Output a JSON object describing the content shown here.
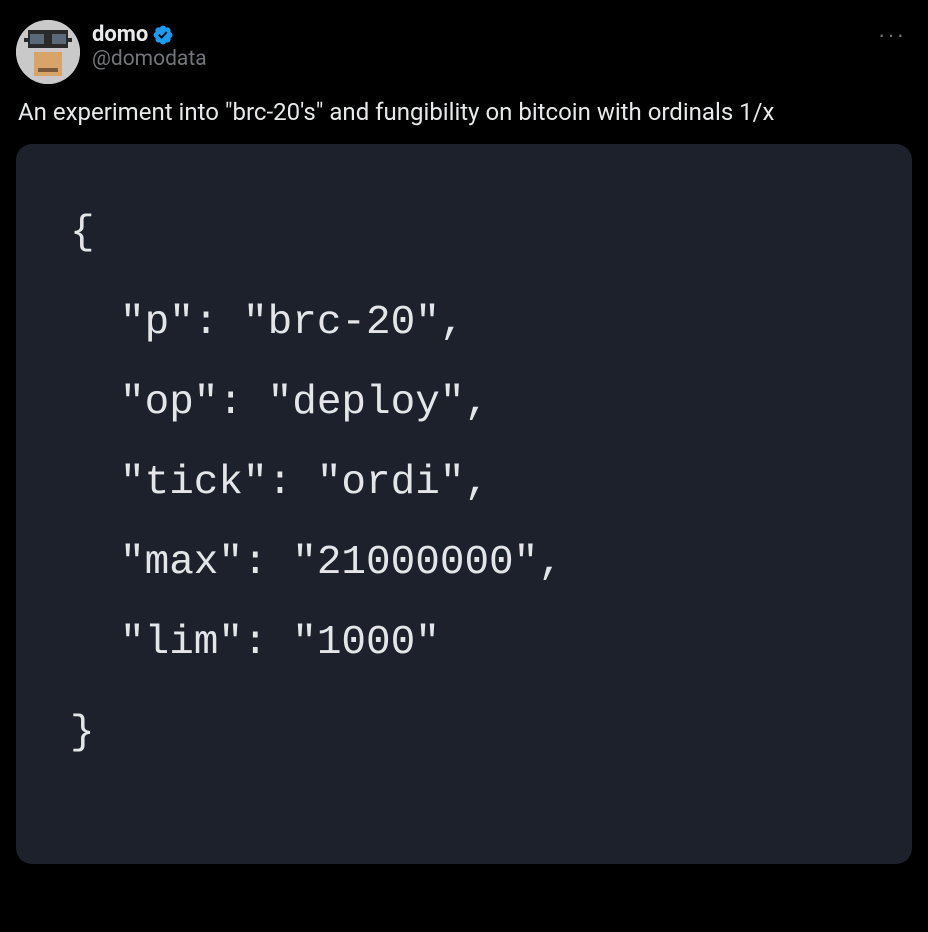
{
  "user": {
    "display_name": "domo",
    "handle": "@domodata"
  },
  "tweet_text": "An experiment into \"brc-20's\" and fungibility on bitcoin with ordinals 1/x",
  "code": {
    "open": "{",
    "line1": "\"p\": \"brc-20\",",
    "line2": "\"op\": \"deploy\",",
    "line3": "\"tick\": \"ordi\",",
    "line4": "\"max\": \"21000000\",",
    "line5": "\"lim\": \"1000\"",
    "close": "}"
  },
  "more_label": "···"
}
